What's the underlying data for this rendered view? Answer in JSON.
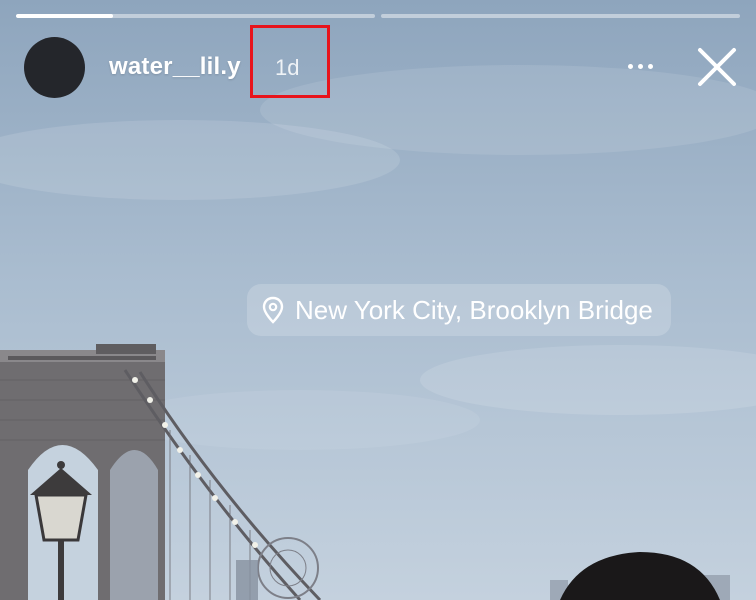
{
  "story": {
    "progress_segments": [
      {
        "progress": 0.27
      },
      {
        "progress": 0.0
      }
    ],
    "username": "water__lil.y",
    "time_ago": "1d"
  },
  "location_sticker": {
    "text": "New York City, Brooklyn Bridge",
    "icon": "location-pin-icon"
  },
  "header_actions": {
    "more_icon": "more-dots-icon",
    "close_icon": "close-icon"
  },
  "colors": {
    "highlight_box": "#e8141c",
    "avatar": "#24262b"
  }
}
